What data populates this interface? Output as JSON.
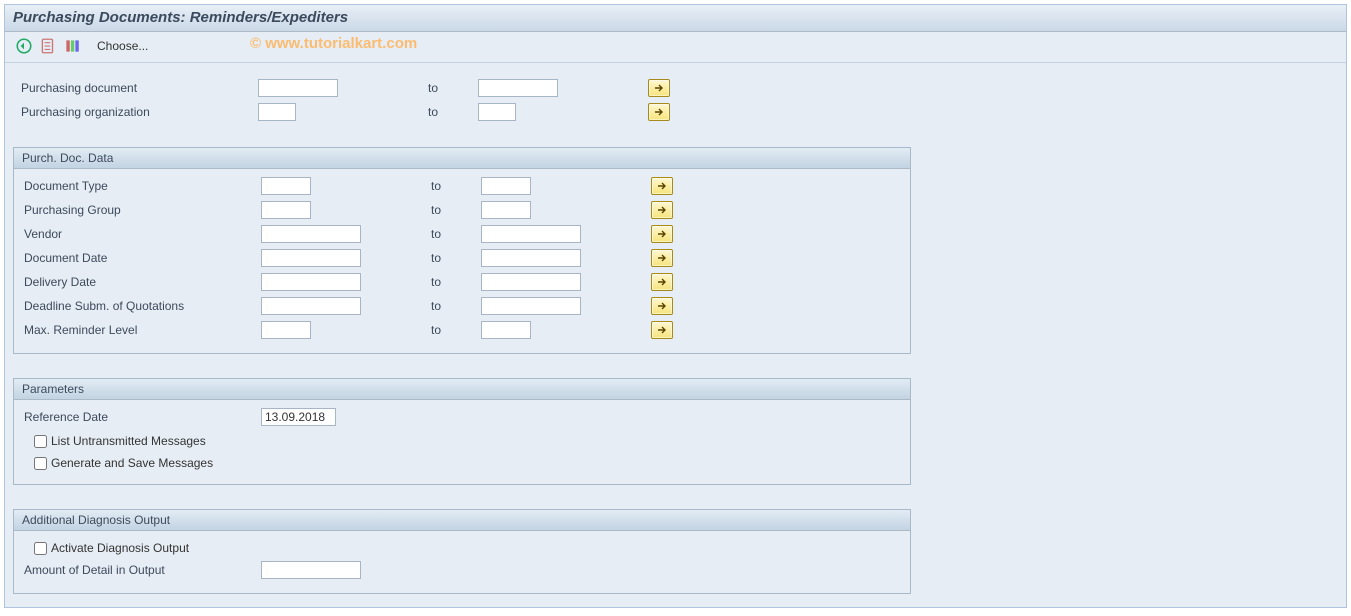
{
  "header": {
    "title": "Purchasing Documents: Reminders/Expediters"
  },
  "toolbar": {
    "choose_label": "Choose...",
    "watermark": "© www.tutorialkart.com"
  },
  "labels": {
    "to": "to"
  },
  "top_rows": [
    {
      "label": "Purchasing document",
      "from": "",
      "to": ""
    },
    {
      "label": "Purchasing organization",
      "from": "",
      "to": ""
    }
  ],
  "groups": {
    "purch_doc": {
      "title": "Purch. Doc. Data",
      "rows": [
        {
          "label": "Document Type",
          "from": "",
          "to": "",
          "size": "short"
        },
        {
          "label": "Purchasing Group",
          "from": "",
          "to": "",
          "size": "short"
        },
        {
          "label": "Vendor",
          "from": "",
          "to": "",
          "size": "long"
        },
        {
          "label": "Document Date",
          "from": "",
          "to": "",
          "size": "long"
        },
        {
          "label": "Delivery Date",
          "from": "",
          "to": "",
          "size": "long"
        },
        {
          "label": "Deadline Subm. of Quotations",
          "from": "",
          "to": "",
          "size": "long"
        },
        {
          "label": "Max. Reminder Level",
          "from": "",
          "to": "",
          "size": "short"
        }
      ]
    },
    "parameters": {
      "title": "Parameters",
      "ref_date_label": "Reference Date",
      "ref_date_value": "13.09.2018",
      "check1": "List Untransmitted Messages",
      "check2": "Generate and Save Messages"
    },
    "diag": {
      "title": "Additional Diagnosis Output",
      "check": "Activate Diagnosis Output",
      "amount_label": "Amount of Detail in Output",
      "amount_value": ""
    }
  }
}
